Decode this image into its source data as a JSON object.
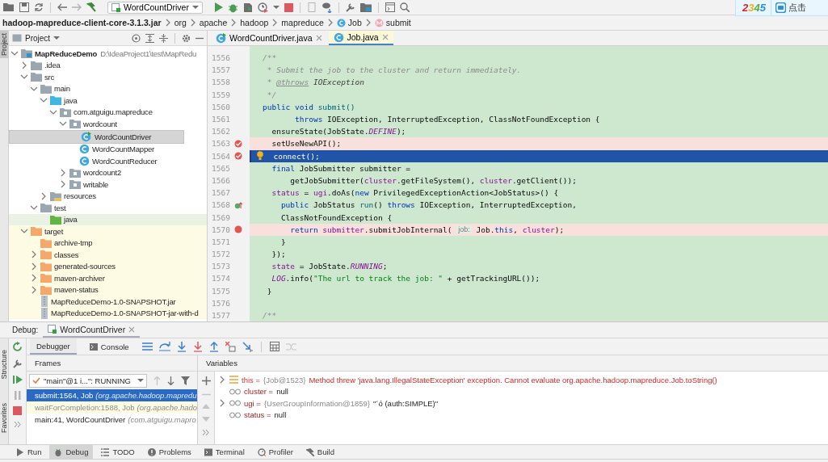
{
  "toolbar": {
    "run_config": "WordCountDriver"
  },
  "corner_widget": {
    "logo": "2345",
    "label": "点击"
  },
  "breadcrumbs": [
    {
      "label": "hadoop-mapreduce-client-core-3.1.3.jar",
      "kind": "archive"
    },
    {
      "label": "org",
      "kind": "package"
    },
    {
      "label": "apache",
      "kind": "package"
    },
    {
      "label": "hadoop",
      "kind": "package"
    },
    {
      "label": "mapreduce",
      "kind": "package"
    },
    {
      "label": "Job",
      "kind": "class"
    },
    {
      "label": "submit",
      "kind": "method"
    }
  ],
  "side_tabs": {
    "top": [
      "Project"
    ],
    "bottom": [
      "Structure",
      "Favorites"
    ]
  },
  "project": {
    "title": "Project",
    "tree": [
      {
        "name": "MapReduceDemo",
        "path": "D:\\IdeaProject1\\test\\MapRedu",
        "kind": "module",
        "expanded": true,
        "selected": false,
        "children": [
          {
            "name": ".idea",
            "kind": "folder",
            "expanded": false,
            "selected": false
          },
          {
            "name": "src",
            "kind": "folder",
            "expanded": true,
            "selected": false,
            "children": [
              {
                "name": "main",
                "kind": "folder",
                "expanded": true,
                "selected": false,
                "children": [
                  {
                    "name": "java",
                    "kind": "source-root",
                    "expanded": true,
                    "selected": false,
                    "children": [
                      {
                        "name": "com.atguigu.mapreduce",
                        "kind": "package",
                        "expanded": true,
                        "selected": false,
                        "children": [
                          {
                            "name": "wordcount",
                            "kind": "package",
                            "expanded": true,
                            "selected": false,
                            "children": [
                              {
                                "name": "WordCountDriver",
                                "kind": "runnable-class",
                                "selected": true
                              },
                              {
                                "name": "WordCountMapper",
                                "kind": "class",
                                "selected": false
                              },
                              {
                                "name": "WordCountReducer",
                                "kind": "class",
                                "selected": false
                              }
                            ]
                          },
                          {
                            "name": "wordcount2",
                            "kind": "package",
                            "expanded": false,
                            "selected": false
                          },
                          {
                            "name": "writable",
                            "kind": "package",
                            "expanded": false,
                            "selected": false
                          }
                        ]
                      }
                    ]
                  },
                  {
                    "name": "resources",
                    "kind": "resources-root",
                    "expanded": false,
                    "selected": false
                  }
                ]
              },
              {
                "name": "test",
                "kind": "folder",
                "expanded": true,
                "selected": false,
                "children": [
                  {
                    "name": "java",
                    "kind": "test-root",
                    "selected": false
                  }
                ]
              }
            ]
          },
          {
            "name": "target",
            "kind": "excluded-root",
            "expanded": true,
            "selected": false,
            "children": [
              {
                "name": "archive-tmp",
                "kind": "excluded-folder",
                "selected": false
              },
              {
                "name": "classes",
                "kind": "excluded-folder",
                "expanded": false,
                "selected": false
              },
              {
                "name": "generated-sources",
                "kind": "excluded-folder",
                "expanded": false,
                "selected": false
              },
              {
                "name": "maven-archiver",
                "kind": "excluded-folder",
                "expanded": false,
                "selected": false
              },
              {
                "name": "maven-status",
                "kind": "excluded-folder",
                "expanded": false,
                "selected": false
              },
              {
                "name": "MapReduceDemo-1.0-SNAPSHOT.jar",
                "kind": "jar",
                "selected": false
              },
              {
                "name": "MapReduceDemo-1.0-SNAPSHOT-jar-with-d",
                "kind": "jar",
                "selected": false
              }
            ]
          }
        ]
      }
    ]
  },
  "editor": {
    "tabs": [
      {
        "label": "WordCountDriver.java",
        "kind": "runnable-class",
        "selected": false
      },
      {
        "label": "Job.java",
        "kind": "class",
        "selected": true
      }
    ],
    "lines": [
      {
        "number": "1556",
        "breakpoint": false,
        "current": false,
        "tokens": [
          {
            "kind": "comment",
            "text": "/**"
          }
        ]
      },
      {
        "number": "1557",
        "breakpoint": false,
        "current": false,
        "tokens": [
          {
            "kind": "comment",
            "text": " * Submit the job to the cluster and return immediately."
          }
        ]
      },
      {
        "number": "1558",
        "breakpoint": false,
        "current": false,
        "tokens": [
          {
            "kind": "comment",
            "text": " * "
          },
          {
            "kind": "doc-tag",
            "text": "@throws"
          },
          {
            "kind": "doc-ref",
            "text": " IOException"
          }
        ]
      },
      {
        "number": "1559",
        "breakpoint": false,
        "current": false,
        "tokens": [
          {
            "kind": "comment",
            "text": " */"
          }
        ]
      },
      {
        "number": "1560",
        "breakpoint": false,
        "current": false,
        "tokens": [
          {
            "kind": "keyword",
            "text": "public void "
          },
          {
            "kind": "declaration",
            "text": "submit()"
          }
        ]
      },
      {
        "number": "1561",
        "breakpoint": false,
        "current": false,
        "tokens": [
          {
            "kind": "keyword",
            "text": "       throws"
          },
          {
            "kind": "plain",
            "text": " IOException, InterruptedException, ClassNotFoundException {"
          }
        ]
      },
      {
        "number": "1562",
        "breakpoint": false,
        "current": false,
        "tokens": [
          {
            "kind": "plain",
            "text": "  ensureState(JobState."
          },
          {
            "kind": "constant",
            "text": "DEFINE"
          },
          {
            "kind": "plain",
            "text": ");"
          }
        ]
      },
      {
        "number": "1563",
        "breakpoint": true,
        "verified": true,
        "current": false,
        "tokens": [
          {
            "kind": "plain",
            "text": "  setUseNewAPI();"
          }
        ]
      },
      {
        "number": "1564",
        "breakpoint": true,
        "verified": true,
        "current": true,
        "tokens": [
          {
            "kind": "plain",
            "text": "  connect();"
          }
        ]
      },
      {
        "number": "1565",
        "breakpoint": false,
        "current": false,
        "tokens": [
          {
            "kind": "keyword",
            "text": "  final"
          },
          {
            "kind": "plain",
            "text": " JobSubmitter submitter ="
          }
        ]
      },
      {
        "number": "1566",
        "breakpoint": false,
        "current": false,
        "tokens": [
          {
            "kind": "plain",
            "text": "      getJobSubmitter("
          },
          {
            "kind": "field",
            "text": "cluster"
          },
          {
            "kind": "plain",
            "text": ".getFileSystem(), "
          },
          {
            "kind": "field",
            "text": "cluster"
          },
          {
            "kind": "plain",
            "text": ".getClient());"
          }
        ]
      },
      {
        "number": "1567",
        "breakpoint": false,
        "current": false,
        "tokens": [
          {
            "kind": "field",
            "text": "  status"
          },
          {
            "kind": "plain",
            "text": " = "
          },
          {
            "kind": "field",
            "text": "ugi"
          },
          {
            "kind": "plain",
            "text": ".doAs("
          },
          {
            "kind": "keyword",
            "text": "new"
          },
          {
            "kind": "plain",
            "text": " PrivilegedExceptionAction<JobStatus>() {"
          }
        ]
      },
      {
        "number": "1568",
        "breakpoint": false,
        "current": false,
        "override": true,
        "tokens": [
          {
            "kind": "keyword",
            "text": "    public"
          },
          {
            "kind": "plain",
            "text": " JobStatus "
          },
          {
            "kind": "declaration",
            "text": "run"
          },
          {
            "kind": "plain",
            "text": "() "
          },
          {
            "kind": "keyword",
            "text": "throws"
          },
          {
            "kind": "plain",
            "text": " IOException, InterruptedException,"
          }
        ]
      },
      {
        "number": "1569",
        "breakpoint": false,
        "current": false,
        "tokens": [
          {
            "kind": "plain",
            "text": "    ClassNotFoundException {"
          }
        ]
      },
      {
        "number": "1570",
        "breakpoint": true,
        "verified": false,
        "current": false,
        "tokens": [
          {
            "kind": "keyword",
            "text": "      return "
          },
          {
            "kind": "field",
            "text": "submitter"
          },
          {
            "kind": "plain",
            "text": ".submitJobInternal( "
          },
          {
            "kind": "hint",
            "text": "job:"
          },
          {
            "kind": "plain",
            "text": " Job."
          },
          {
            "kind": "keyword",
            "text": "this"
          },
          {
            "kind": "plain",
            "text": ", "
          },
          {
            "kind": "field",
            "text": "cluster"
          },
          {
            "kind": "plain",
            "text": ");"
          }
        ]
      },
      {
        "number": "1571",
        "breakpoint": false,
        "current": false,
        "tokens": [
          {
            "kind": "plain",
            "text": "    }"
          }
        ]
      },
      {
        "number": "1572",
        "breakpoint": false,
        "current": false,
        "tokens": [
          {
            "kind": "plain",
            "text": "  });"
          }
        ]
      },
      {
        "number": "1573",
        "breakpoint": false,
        "current": false,
        "tokens": [
          {
            "kind": "field",
            "text": "  state"
          },
          {
            "kind": "plain",
            "text": " = JobState."
          },
          {
            "kind": "constant",
            "text": "RUNNING"
          },
          {
            "kind": "plain",
            "text": ";"
          }
        ]
      },
      {
        "number": "1574",
        "breakpoint": false,
        "current": false,
        "tokens": [
          {
            "kind": "constant",
            "text": "  LOG"
          },
          {
            "kind": "plain",
            "text": ".info("
          },
          {
            "kind": "string",
            "text": "\"The url to track the job: \""
          },
          {
            "kind": "plain",
            "text": " + getTrackingURL());"
          }
        ]
      },
      {
        "number": "1575",
        "breakpoint": false,
        "current": false,
        "tokens": [
          {
            "kind": "plain",
            "text": " }"
          }
        ]
      },
      {
        "number": "1576",
        "breakpoint": false,
        "current": false
      },
      {
        "number": "1577",
        "breakpoint": false,
        "current": false,
        "tokens": [
          {
            "kind": "comment",
            "text": "/**"
          }
        ]
      }
    ]
  },
  "debug": {
    "label": "Debug:",
    "tab": "WordCountDriver",
    "tabs": [
      {
        "label": "Debugger",
        "selected": true
      },
      {
        "label": "Console",
        "selected": false
      }
    ],
    "frames_title": "Frames",
    "variables_title": "Variables",
    "thread": "\"main\"@1 i...\": RUNNING",
    "frames": [
      {
        "method": "submit:1564, Job",
        "location": "(org.apache.hadoop.mapredu",
        "kind": "library",
        "selected": true
      },
      {
        "method": "waitForCompletion:1588, Job",
        "location": "(org.apache.hado",
        "kind": "library",
        "selected": false
      },
      {
        "method": "main:41, WordCountDriver",
        "location": "(com.atguigu.mapro",
        "kind": "project",
        "selected": false
      }
    ],
    "variables": [
      {
        "name": "this =",
        "kind": "object",
        "expanded": false,
        "value": "{Job@1523}",
        "error": "Method threw 'java.lang.IllegalStateException' exception. Cannot evaluate org.apache.hadoop.mapreduce.Job.toString()"
      },
      {
        "name": "cluster =",
        "kind": "field",
        "text": "null"
      },
      {
        "name": "ugi =",
        "kind": "field",
        "expanded": false,
        "value": "{UserGroupInformation@1859}",
        "text": "\"´ó (auth:SIMPLE)\""
      },
      {
        "name": "status =",
        "kind": "field",
        "text": "null"
      }
    ]
  },
  "tool_tabs": [
    {
      "label": "Run",
      "selected": false
    },
    {
      "label": "Debug",
      "selected": true
    },
    {
      "label": "TODO",
      "selected": false
    },
    {
      "label": "Problems",
      "selected": false
    },
    {
      "label": "Terminal",
      "selected": false
    },
    {
      "label": "Profiler",
      "selected": false
    },
    {
      "label": "Build",
      "selected": false
    }
  ]
}
